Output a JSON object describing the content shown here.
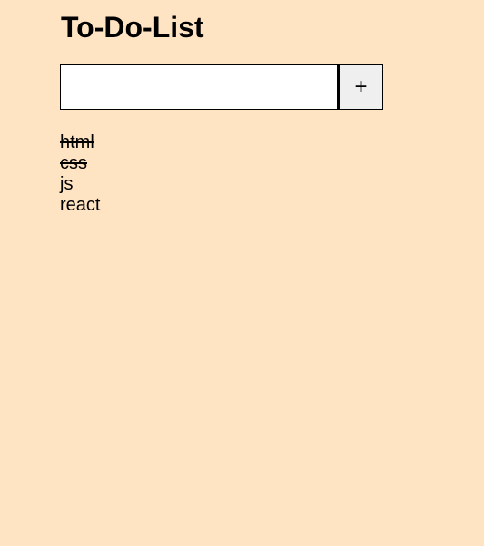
{
  "app": {
    "title": "To-Do-List"
  },
  "form": {
    "input_value": "",
    "input_placeholder": "",
    "add_button_label": "+"
  },
  "todos": [
    {
      "label": "html",
      "done": true
    },
    {
      "label": "css",
      "done": true
    },
    {
      "label": "js",
      "done": false
    },
    {
      "label": "react",
      "done": false
    }
  ],
  "colors": {
    "background": "#FFE4C4",
    "input_background": "#FFFFFF",
    "button_background": "#EFEFEF"
  }
}
